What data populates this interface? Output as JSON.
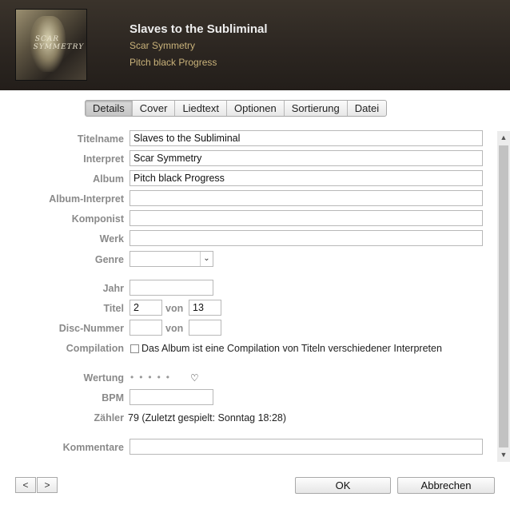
{
  "header": {
    "title": "Slaves to the Subliminal",
    "artist": "Scar Symmetry",
    "album": "Pitch black Progress",
    "cover_logo": "SCAR SYMMETRY"
  },
  "tabs": [
    {
      "label": "Details",
      "active": true
    },
    {
      "label": "Cover"
    },
    {
      "label": "Liedtext"
    },
    {
      "label": "Optionen"
    },
    {
      "label": "Sortierung"
    },
    {
      "label": "Datei"
    }
  ],
  "form": {
    "titelname": {
      "label": "Titelname",
      "value": "Slaves to the Subliminal"
    },
    "interpret": {
      "label": "Interpret",
      "value": "Scar Symmetry"
    },
    "album": {
      "label": "Album",
      "value": "Pitch black Progress"
    },
    "album_interpret": {
      "label": "Album-Interpret",
      "value": ""
    },
    "komponist": {
      "label": "Komponist",
      "value": ""
    },
    "werk": {
      "label": "Werk",
      "value": ""
    },
    "genre": {
      "label": "Genre",
      "value": ""
    },
    "jahr": {
      "label": "Jahr",
      "value": ""
    },
    "titel": {
      "label": "Titel",
      "value": "2",
      "von_label": "von",
      "total": "13"
    },
    "disc": {
      "label": "Disc-Nummer",
      "value": "",
      "von_label": "von",
      "total": ""
    },
    "compilation": {
      "label": "Compilation",
      "checkbox_text": "Das Album ist eine Compilation von Titeln verschiedener Interpreten",
      "checked": false
    },
    "wertung": {
      "label": "Wertung",
      "stars": 0,
      "max_stars": 5,
      "dots": "•••••",
      "heart": "♡"
    },
    "bpm": {
      "label": "BPM",
      "value": ""
    },
    "zaehler": {
      "label": "Zähler",
      "value": "79 (Zuletzt gespielt: Sonntag 18:28)"
    },
    "kommentare": {
      "label": "Kommentare",
      "value": ""
    }
  },
  "buttons": {
    "prev": "<",
    "next": ">",
    "ok": "OK",
    "cancel": "Abbrechen"
  },
  "icons": {
    "genre_dropdown": "chevron-down-icon",
    "scroll_up": "arrow-up-icon",
    "scroll_down": "arrow-down-icon"
  }
}
